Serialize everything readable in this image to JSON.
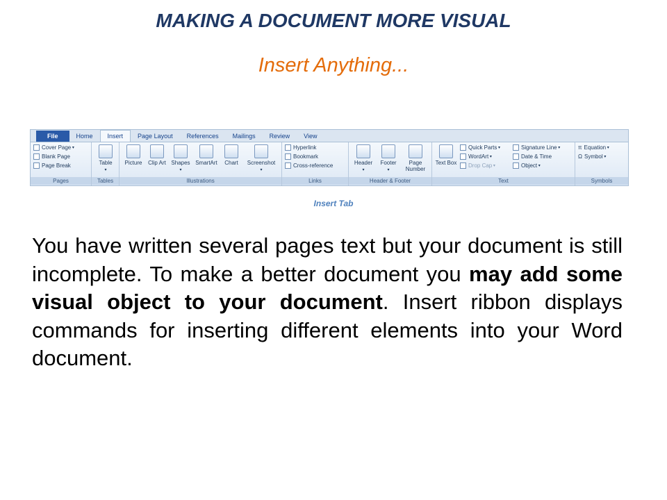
{
  "slide": {
    "title": "MAKING A DOCUMENT MORE VISUAL",
    "subtitle": "Insert Anything...",
    "caption": "Insert Tab"
  },
  "body": {
    "seg1": "You have written several pages text but your document is still incomplete. To make a better document you ",
    "bold": "may add some visual object to your document",
    "seg2": ". Insert ribbon displays commands for inserting different elements into your Word document."
  },
  "ribbon": {
    "tabs": [
      "File",
      "Home",
      "Insert",
      "Page Layout",
      "References",
      "Mailings",
      "Review",
      "View"
    ],
    "pages": {
      "items": [
        "Cover Page",
        "Blank Page",
        "Page Break"
      ],
      "label": "Pages"
    },
    "tables": {
      "item": "Table",
      "label": "Tables"
    },
    "illustrations": {
      "items": [
        "Picture",
        "Clip Art",
        "Shapes",
        "SmartArt",
        "Chart",
        "Screenshot"
      ],
      "label": "Illustrations"
    },
    "links": {
      "items": [
        "Hyperlink",
        "Bookmark",
        "Cross-reference"
      ],
      "label": "Links"
    },
    "header_footer": {
      "items": [
        "Header",
        "Footer",
        "Page Number"
      ],
      "label": "Header & Footer"
    },
    "text": {
      "textbox": "Text Box",
      "items": [
        "Quick Parts",
        "WordArt",
        "Drop Cap",
        "Signature Line",
        "Date & Time",
        "Object"
      ],
      "label": "Text"
    },
    "symbols": {
      "items": [
        "Equation",
        "Symbol"
      ],
      "label": "Symbols"
    }
  },
  "colors": {
    "title": "#1f3864",
    "subtitle": "#e46c0a",
    "caption": "#4f81bd",
    "file_tab": "#2a5aa8"
  }
}
